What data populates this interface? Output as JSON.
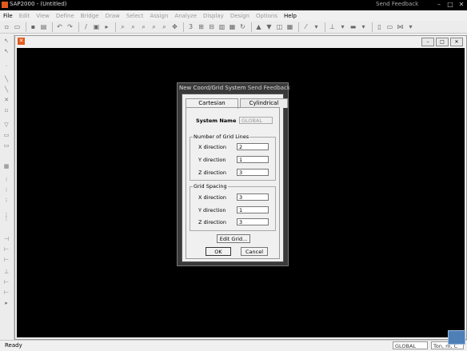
{
  "window": {
    "title": "SAP2000 - (Untitled)",
    "feedback": "Send Feedback",
    "controls": [
      "–",
      "□",
      "✕"
    ]
  },
  "menu": [
    "File",
    "Edit",
    "View",
    "Define",
    "Bridge",
    "Draw",
    "Select",
    "Assign",
    "Analyze",
    "Display",
    "Design",
    "Options",
    "Help"
  ],
  "dialog": {
    "title": "New Coord/Grid System",
    "feedback": "Send Feedback",
    "tabs": [
      "Cartesian",
      "Cylindrical"
    ],
    "system_name_label": "System Name",
    "system_name_value": "GLOBAL",
    "grid_lines_group": "Number of Grid Lines",
    "grid_lines": [
      {
        "label": "X direction",
        "value": "2"
      },
      {
        "label": "Y direction",
        "value": "1"
      },
      {
        "label": "Z direction",
        "value": "3"
      }
    ],
    "spacing_group": "Grid Spacing",
    "spacing": [
      {
        "label": "X direction",
        "value": "3"
      },
      {
        "label": "Y direction",
        "value": "1"
      },
      {
        "label": "Z direction",
        "value": "3"
      }
    ],
    "edit_grid": "Edit Grid...",
    "ok": "OK",
    "cancel": "Cancel"
  },
  "status": {
    "ready": "Ready",
    "coord_system": "GLOBAL",
    "units": "Ton, m, C"
  },
  "colors": {
    "canvas": "#000000",
    "app_icon": "#e05a1c"
  }
}
